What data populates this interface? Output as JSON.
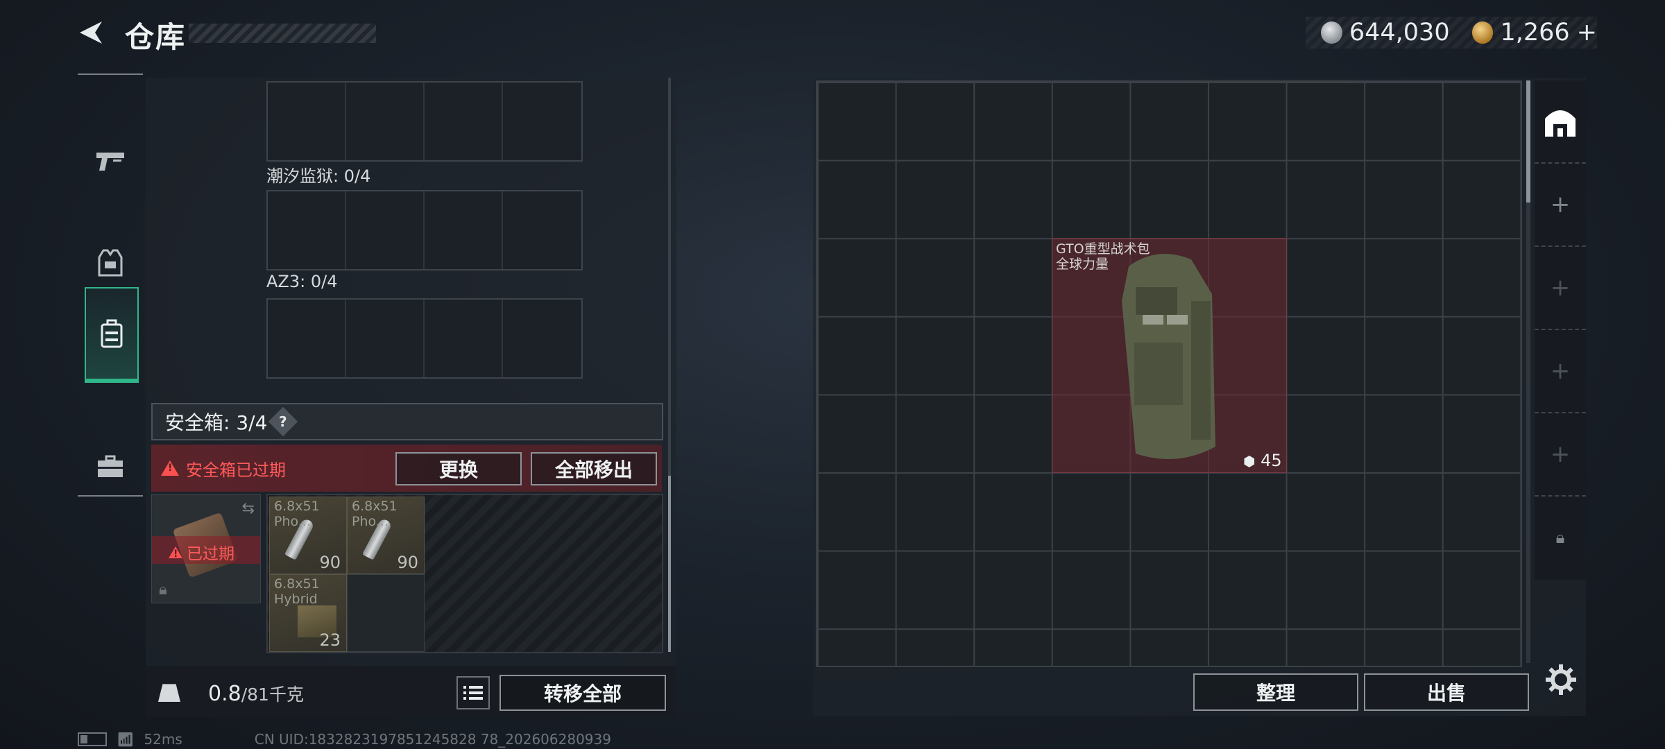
{
  "header": {
    "title": "仓库",
    "currency": [
      {
        "icon": "silver-coin-icon",
        "value": "644,030"
      },
      {
        "icon": "gold-coin-icon",
        "value": "1,266"
      }
    ],
    "add_symbol": "+"
  },
  "left_nav": [
    {
      "icon": "pistol-icon",
      "active": false
    },
    {
      "icon": "vest-icon",
      "active": false
    },
    {
      "icon": "backpack-icon",
      "active": true
    },
    {
      "icon": "toolbox-icon",
      "active": false
    }
  ],
  "slots": {
    "label_1": "潮汐监狱: 0/4",
    "label_2": "AZ3: 0/4"
  },
  "safebox": {
    "label": "安全箱: 3/4",
    "help": "?",
    "expired_text": "安全箱已过期",
    "replace_button": "更换",
    "remove_all_button": "全部移出",
    "case_status": "已过期",
    "items": [
      {
        "name": "6.8x51\nPho...",
        "count": "90"
      },
      {
        "name": "6.8x51\nPho...",
        "count": "90"
      },
      {
        "name": "6.8x51\nHybrid",
        "count": "23"
      }
    ]
  },
  "weight": {
    "value": "0.8",
    "max": "/81千克"
  },
  "transfer_all_button": "转移全部",
  "stash": {
    "item": {
      "name_line1": "GTO重型战术包",
      "name_line2": "全球力量",
      "weight": "45"
    },
    "sort_button": "整理",
    "sell_button": "出售"
  },
  "footer": {
    "ping": "52ms",
    "uid": "CN UID:1832823197851245828 78_202606280939"
  },
  "colors": {
    "accent_green": "#2fb78a",
    "expired_red": "#ff5a5a",
    "item_bg": "#6e2832"
  }
}
